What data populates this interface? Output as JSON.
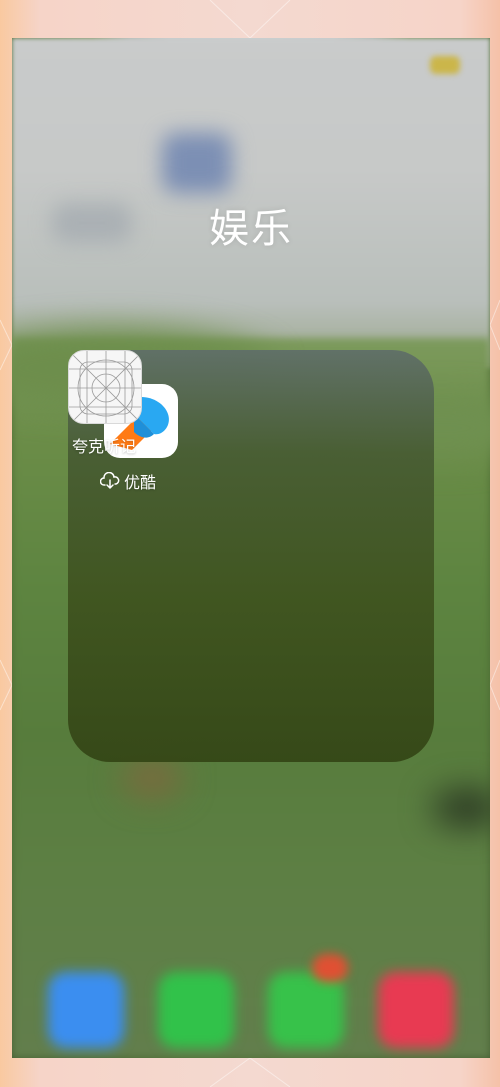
{
  "folder": {
    "title": "娱乐"
  },
  "apps": [
    {
      "name": "夸克听记",
      "icon": "app-placeholder-icon"
    },
    {
      "name": "优酷",
      "icon": "youku-icon",
      "status_icon": "icloud-download-icon"
    }
  ],
  "dock": {
    "items": [
      {
        "icon": "safari-icon",
        "color": "#3b8ef0"
      },
      {
        "icon": "phone-icon",
        "color": "#31c24a"
      },
      {
        "icon": "messages-icon",
        "color": "#37c24a",
        "badge": true
      },
      {
        "icon": "music-icon",
        "color": "#e83a52"
      }
    ]
  },
  "colors": {
    "folder_panel": "#3f5524",
    "youku_orange": "#ff7a14",
    "youku_blue": "#29a8f2",
    "badge_red": "#e05033"
  }
}
